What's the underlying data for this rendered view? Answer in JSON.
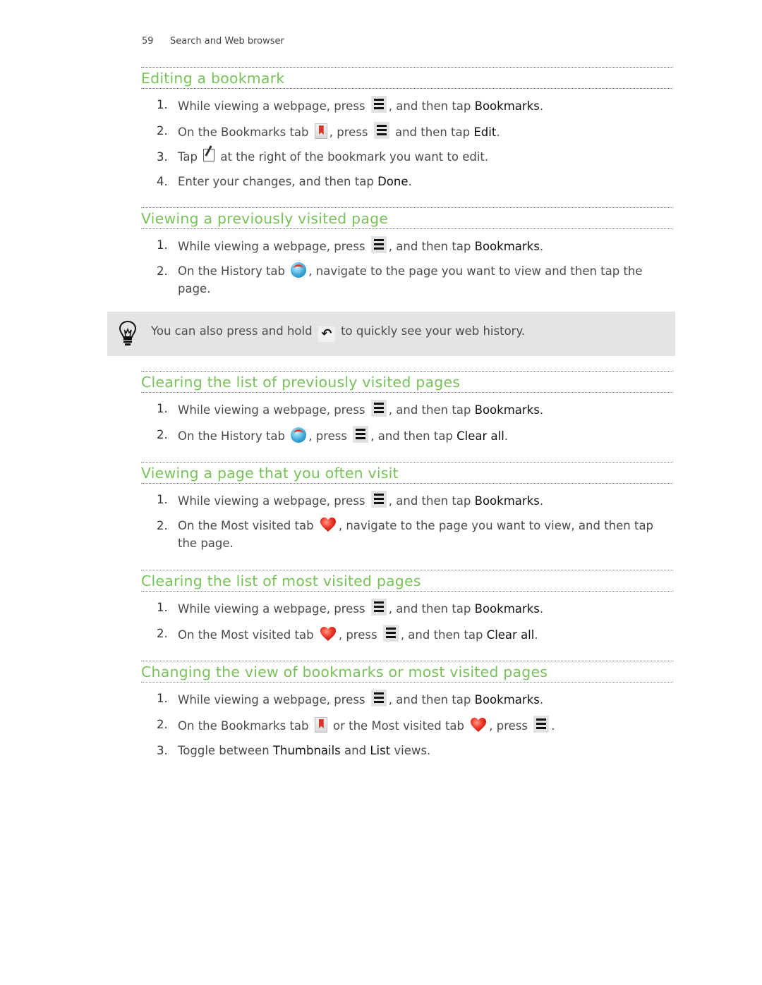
{
  "header": {
    "page_number": "59",
    "chapter": "Search and Web browser"
  },
  "sections": [
    {
      "title": "Editing a bookmark",
      "steps": [
        {
          "num": "1.",
          "parts": [
            "While viewing a webpage, press ",
            "[menu-icon]",
            ", and then tap ",
            "Bookmarks",
            "."
          ]
        },
        {
          "num": "2.",
          "parts": [
            "On the Bookmarks tab ",
            "[bookmark-icon]",
            ", press ",
            "[menu-icon]",
            " and then tap ",
            "Edit",
            "."
          ]
        },
        {
          "num": "3.",
          "parts": [
            "Tap ",
            "[edit-icon]",
            " at the right of the bookmark you want to edit."
          ]
        },
        {
          "num": "4.",
          "parts": [
            "Enter your changes, and then tap ",
            "Done",
            "."
          ]
        }
      ]
    },
    {
      "title": "Viewing a previously visited page",
      "steps": [
        {
          "num": "1.",
          "parts": [
            "While viewing a webpage, press ",
            "[menu-icon]",
            ", and then tap ",
            "Bookmarks",
            "."
          ]
        },
        {
          "num": "2.",
          "parts": [
            "On the History tab ",
            "[history-icon]",
            ", navigate to the page you want to view and then tap the page."
          ]
        }
      ]
    },
    {
      "title": "Clearing the list of previously visited pages",
      "steps": [
        {
          "num": "1.",
          "parts": [
            "While viewing a webpage, press ",
            "[menu-icon]",
            ", and then tap ",
            "Bookmarks",
            "."
          ]
        },
        {
          "num": "2.",
          "parts": [
            "On the History tab ",
            "[history-icon]",
            ", press ",
            "[menu-icon]",
            ", and then tap ",
            "Clear all",
            "."
          ]
        }
      ]
    },
    {
      "title": "Viewing a page that you often visit",
      "steps": [
        {
          "num": "1.",
          "parts": [
            "While viewing a webpage, press ",
            "[menu-icon]",
            ", and then tap ",
            "Bookmarks",
            "."
          ]
        },
        {
          "num": "2.",
          "parts": [
            "On the Most visited tab ",
            "[heart-icon]",
            ", navigate to the page you want to view, and then tap the page."
          ]
        }
      ]
    },
    {
      "title": "Clearing the list of most visited pages",
      "steps": [
        {
          "num": "1.",
          "parts": [
            "While viewing a webpage, press ",
            "[menu-icon]",
            ", and then tap ",
            "Bookmarks",
            "."
          ]
        },
        {
          "num": "2.",
          "parts": [
            "On the Most visited tab ",
            "[heart-icon]",
            ", press ",
            "[menu-icon]",
            ", and then tap ",
            "Clear all",
            "."
          ]
        }
      ]
    },
    {
      "title": "Changing the view of bookmarks or most visited pages",
      "steps": [
        {
          "num": "1.",
          "parts": [
            "While viewing a webpage, press ",
            "[menu-icon]",
            ", and then tap ",
            "Bookmarks",
            "."
          ]
        },
        {
          "num": "2.",
          "parts": [
            "On the Bookmarks tab ",
            "[bookmark-icon]",
            " or the Most visited tab ",
            "[heart-icon]",
            ", press ",
            "[menu-icon]",
            "."
          ]
        },
        {
          "num": "3.",
          "parts": [
            "Toggle between ",
            "Thumbnails",
            " and ",
            "List",
            " views."
          ]
        }
      ]
    }
  ],
  "tip": {
    "icon": "lightbulb-icon",
    "before": "You can also press and hold ",
    "icon_inline": "back-icon",
    "after": " to quickly see your web history."
  },
  "terms": [
    "Bookmarks",
    "Edit",
    "Done",
    "Clear all",
    "Thumbnails",
    "List"
  ],
  "colors": {
    "heading": "#78c25a",
    "tip_background": "#e4e4e4"
  }
}
